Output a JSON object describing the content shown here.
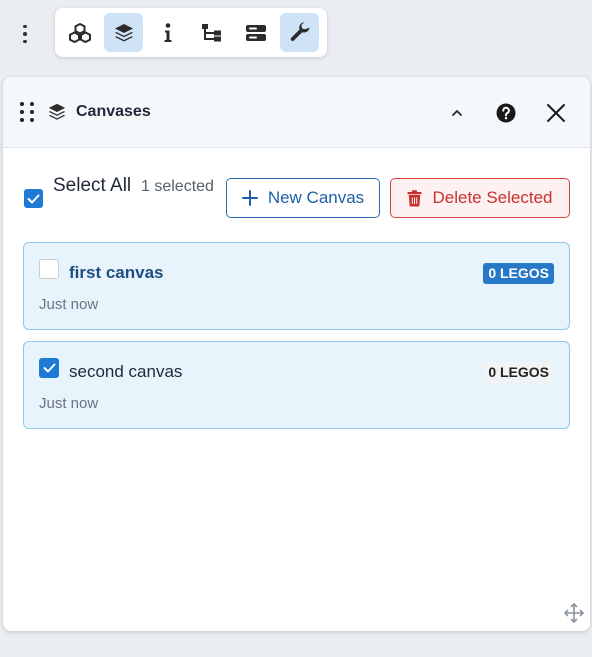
{
  "toolbar": {
    "items": [
      {
        "icon": "cubes-icon",
        "active": false
      },
      {
        "icon": "layers-icon",
        "active": true
      },
      {
        "icon": "info-icon",
        "active": false
      },
      {
        "icon": "hierarchy-icon",
        "active": false
      },
      {
        "icon": "server-icon",
        "active": false
      },
      {
        "icon": "wrench-icon",
        "active": true
      }
    ]
  },
  "panel": {
    "title": "Canvases",
    "select_all_label": "Select All",
    "selected_count": "1 selected",
    "new_canvas_label": "New Canvas",
    "delete_selected_label": "Delete Selected"
  },
  "canvases": [
    {
      "name": "first canvas",
      "time": "Just now",
      "badge": "0 LEGOS",
      "checked": false,
      "emphasized": true
    },
    {
      "name": "second canvas",
      "time": "Just now",
      "badge": "0 LEGOS",
      "checked": true,
      "emphasized": false
    }
  ],
  "colors": {
    "accent": "#1f7ad6",
    "danger": "#c8312f",
    "card_bg": "#e8f4fc",
    "card_border": "#8ec7e8"
  }
}
